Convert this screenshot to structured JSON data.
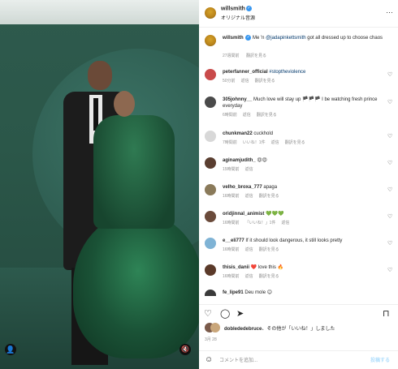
{
  "post": {
    "author": "willsmith",
    "subtitle": "オリジナル音源"
  },
  "caption": {
    "user": "willsmith",
    "text_a": "Me 'n",
    "mention": "@jadapinkettsmith",
    "text_b": "got all dressed up to choose chaos",
    "time": "27週間前",
    "translate": "翻訳を見る"
  },
  "comments": [
    {
      "user": "peterfanner_official",
      "text": "#stoptheviolence",
      "time": "50分前",
      "likes": "返信",
      "extra": "翻訳を見る"
    },
    {
      "user": "305johnny__",
      "text": "Much love will stay up 🏴🏴🏴 I be watching fresh prince everyday",
      "time": "6時間前",
      "likes": "返信",
      "extra": "翻訳を見る"
    },
    {
      "user": "chunkman22",
      "text": "cuckhold",
      "time": "7時間前",
      "likes": "いいね！1件",
      "extra": "返信",
      "extra2": "翻訳を見る"
    },
    {
      "user": "aginamjudith_",
      "text": "😍😍",
      "time": "15時間前",
      "likes": "返信"
    },
    {
      "user": "velho_broxa_777",
      "text": "apaga",
      "time": "16時間前",
      "likes": "返信",
      "extra": "翻訳を見る"
    },
    {
      "user": "oridjinnal_animist",
      "text": "💚💚💚",
      "time": "16時間前",
      "likes": "「いいね！」1件",
      "extra": "返信"
    },
    {
      "user": "e__eli777",
      "text": "If it should look dangerous, it still looks pretty",
      "time": "16時間前",
      "likes": "返信",
      "extra": "翻訳を見る"
    },
    {
      "user": "thisis_danii",
      "text": "❤️ love this 🔥",
      "time": "16時間前",
      "likes": "返信",
      "extra": "翻訳を見る"
    },
    {
      "user": "fe_lipe91",
      "text": "Deu mole 😊",
      "time": "",
      "likes": ""
    }
  ],
  "likes_line": {
    "user": "doblededebruce",
    "text": "、その他が「いいね！」しました"
  },
  "date": "3月 28",
  "add_comment": {
    "placeholder": "コメントを追加...",
    "post_label": "投稿する"
  },
  "colors": {
    "verified": "#3897f0",
    "link": "#00376b",
    "muted": "#8e8e8e",
    "post_button": "#b2dffc"
  },
  "icons": {
    "heart": "♡",
    "comment": "◯",
    "share": "➤",
    "bookmark": "⊓",
    "emoji": "☺",
    "more": "…",
    "user_tag": "👤",
    "mute": "🔇"
  }
}
